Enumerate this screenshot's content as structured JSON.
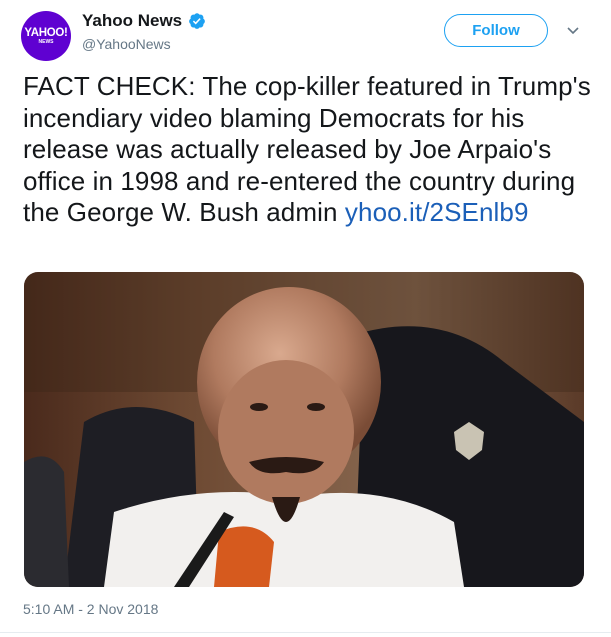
{
  "account": {
    "avatar_main": "YAHOO!",
    "avatar_sub": "NEWS",
    "display_name": "Yahoo News",
    "handle": "@YahooNews"
  },
  "actions": {
    "follow_label": "Follow"
  },
  "tweet": {
    "text": "FACT CHECK: The cop-killer featured in Trump's incendiary video blaming Democrats for his release was actually released by Joe Arpaio's office in 1998 and re-entered the country during the George W. Bush admin",
    "link": "yhoo.it/2SEnlb9",
    "timestamp": "5:10 AM - 2 Nov 2018"
  },
  "colors": {
    "accent": "#1da1f2",
    "link": "#1b5fb8",
    "avatar_bg": "#5f01d1"
  },
  "icons": [
    "verified-badge-icon",
    "chevron-down-icon"
  ]
}
